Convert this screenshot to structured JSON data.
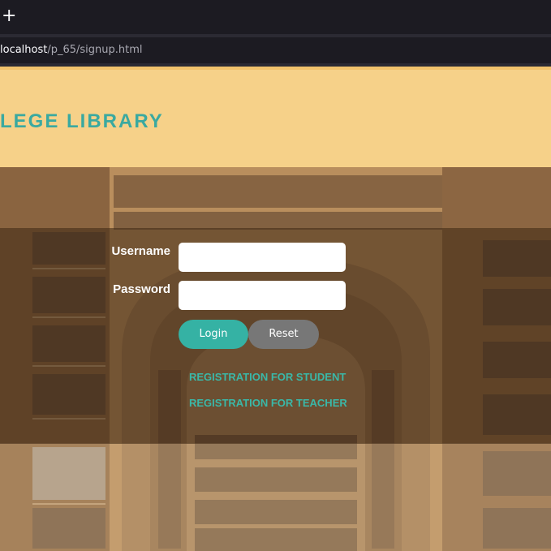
{
  "browser": {
    "new_tab_glyph": "+",
    "url_host": "localhost",
    "url_path": "/p_65/signup.html"
  },
  "header": {
    "title": "LEGE LIBRARY"
  },
  "login_form": {
    "username_label": "Username",
    "password_label": "Password",
    "username_value": "",
    "password_value": "",
    "login_label": "Login",
    "reset_label": "Reset"
  },
  "links": {
    "student": "REGISTRATION FOR STUDENT",
    "teacher": "REGISTRATION FOR TEACHER"
  },
  "colors": {
    "header_bg": "#f6d189",
    "title": "#3aa9a0",
    "login_button": "#35b2a4",
    "reset_button": "#777777",
    "link": "#3ab8a8"
  }
}
